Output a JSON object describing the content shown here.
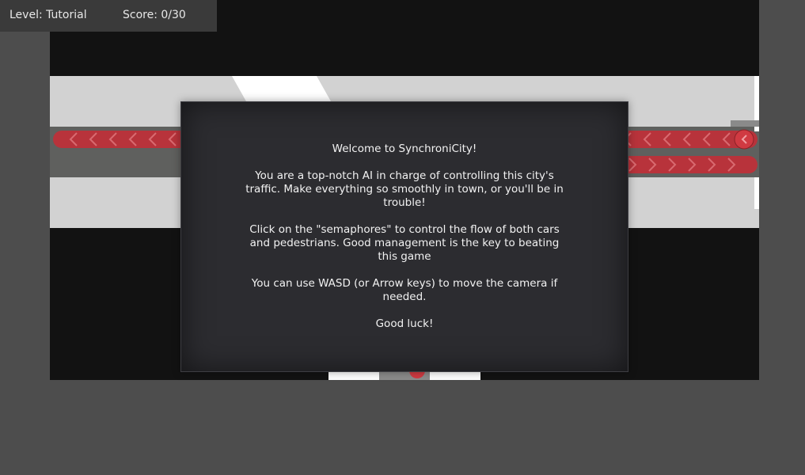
{
  "hud": {
    "level_label": "Level: Tutorial",
    "score_label": "Score: 0/30"
  },
  "dialog": {
    "title": "Welcome to SynchroniCity!",
    "paragraphs": [
      "You are a top-notch AI in charge of controlling this city's traffic. Make everything so smoothly in town, or you'll be in trouble!",
      "Click on the \"semaphores\" to control the flow of both cars and pedestrians. Good management is the key to beating this game",
      "You can use WASD (or Arrow keys) to move the camera if needed.",
      "Good luck!"
    ]
  },
  "colors": {
    "background": "#4d4d4d",
    "viewport": "#121212",
    "sidewalk": "#d2d2d2",
    "road": "#5f605e",
    "lane_marker": "#b8333b",
    "dialog": "#2c2c30",
    "hud": "#3a3a3a"
  }
}
